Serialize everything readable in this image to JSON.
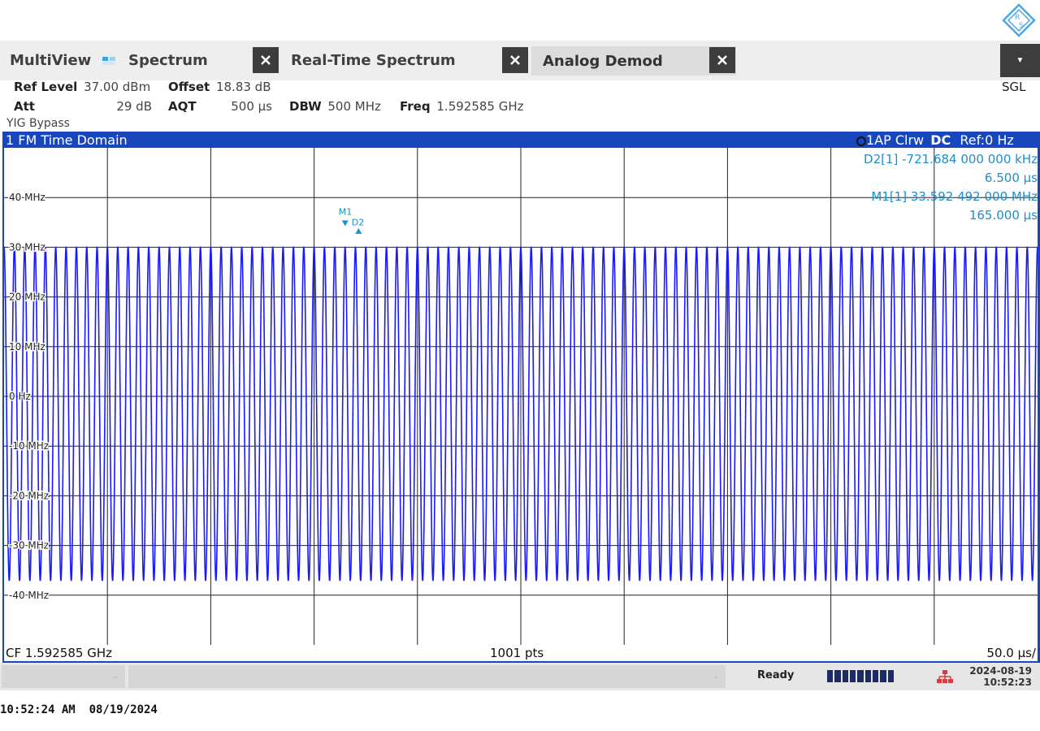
{
  "tabs": [
    {
      "label": "MultiView",
      "active": false
    },
    {
      "label": "Spectrum",
      "active": false
    },
    {
      "label": "Real-Time Spectrum",
      "active": false
    },
    {
      "label": "Analog Demod",
      "active": true
    }
  ],
  "sweep_mode": "SGL",
  "settings": {
    "ref_level_label": "Ref Level",
    "ref_level_value": "37.00 dBm",
    "offset_label": "Offset",
    "offset_value": "18.83 dB",
    "att_label": "Att",
    "att_value": "29 dB",
    "aqt_label": "AQT",
    "aqt_value": "500 µs",
    "dbw_label": "DBW",
    "dbw_value": "500 MHz",
    "freq_label": "Freq",
    "freq_value": "1.592585 GHz",
    "yig": "YIG Bypass"
  },
  "diagram": {
    "title": "1 FM Time Domain",
    "trace_info_prefix": "1AP Clrw",
    "coupling": "DC",
    "ref_label": "Ref:",
    "ref_value": "0 Hz",
    "markers": [
      {
        "name": "D2[1]",
        "value": "-721.684 000 000 kHz",
        "x": "6.500 µs"
      },
      {
        "name": "M1[1]",
        "value": "33.592 492 000 MHz",
        "x": "165.000 µs"
      }
    ],
    "marker_labels": {
      "m1": "M1",
      "d2": "D2"
    },
    "cf": "CF 1.592585 GHz",
    "points": "1001 pts",
    "per_div": "50.0 µs/"
  },
  "chart_data": {
    "type": "line",
    "title": "1 FM Time Domain",
    "xlabel": "",
    "ylabel": "",
    "x_range_us": [
      0,
      500
    ],
    "ylim_mhz": [
      -50,
      50
    ],
    "y_ticks": [
      "40 MHz",
      "30 MHz",
      "20 MHz",
      "10 MHz",
      "0 Hz",
      "-10 MHz",
      "-20 MHz",
      "-30 MHz",
      "-40 MHz"
    ],
    "grid": true,
    "series": [
      {
        "color": "#1a1aff",
        "waveform": "sine",
        "cycles": 100,
        "amplitude_mhz": 33.6,
        "offset_mhz": -3.5,
        "phase_max_at_us": 165
      }
    ],
    "markers": [
      {
        "name": "M1",
        "x_us": 165.0,
        "y_mhz": 33.592492
      },
      {
        "name": "D2",
        "x_us": 171.5,
        "y_mhz": 32.870808
      }
    ]
  },
  "status": {
    "state": "Ready",
    "date": "2024-08-19",
    "time": "10:52:23"
  },
  "capture_timestamp": "10:52:24 AM  08/19/2024",
  "colors": {
    "window_frame": "#1846bd",
    "trace": "#1a1aff",
    "marker_text": "#1a8fcc"
  }
}
